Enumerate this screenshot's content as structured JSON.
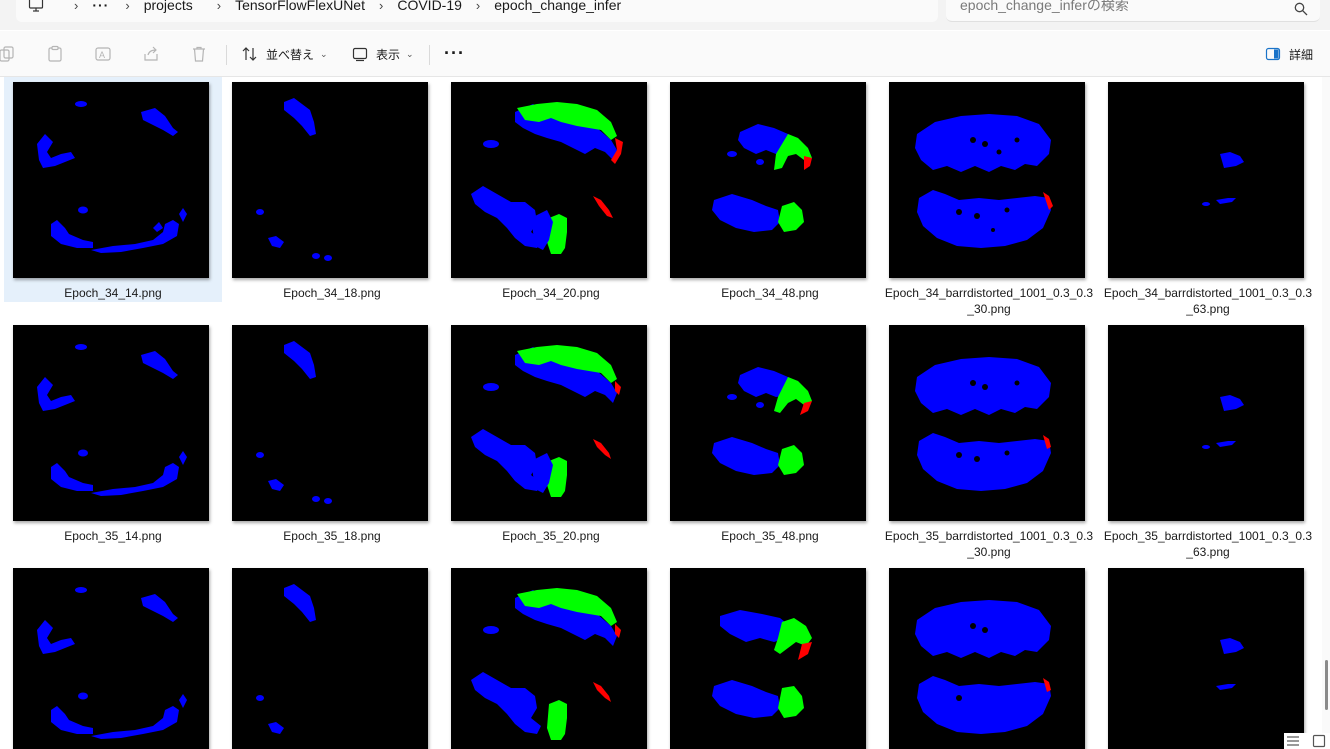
{
  "breadcrumb": {
    "more": "···",
    "items": [
      "projects",
      "TensorFlowFlexUNet",
      "COVID-19",
      "epoch_change_infer"
    ]
  },
  "search": {
    "placeholder": "epoch_change_inferの検索"
  },
  "toolbar": {
    "sort_label": "並べ替え",
    "view_label": "表示",
    "more_label": "···",
    "details_label": "詳細"
  },
  "icons": {
    "pc": "computer-icon",
    "copy": "copy-icon",
    "paste": "paste-icon",
    "rename": "rename-icon",
    "share": "share-icon",
    "delete": "delete-icon",
    "sort": "sort-icon",
    "view": "view-icon",
    "details": "details-pane-icon",
    "search": "search-icon"
  },
  "colors": {
    "selection": "#e5f0fb",
    "seg_blue": "#0000ff",
    "seg_green": "#00ff00",
    "seg_red": "#ff0000",
    "thumb_bg": "#000000"
  },
  "files": [
    [
      "Epoch_34_14.png",
      "Epoch_34_18.png",
      "Epoch_34_20.png",
      "Epoch_34_48.png",
      "Epoch_34_barrdistorted_1001_0.3_0.3_30.png",
      "Epoch_34_barrdistorted_1001_0.3_0.3_63.png"
    ],
    [
      "Epoch_35_14.png",
      "Epoch_35_18.png",
      "Epoch_35_20.png",
      "Epoch_35_48.png",
      "Epoch_35_barrdistorted_1001_0.3_0.3_30.png",
      "Epoch_35_barrdistorted_1001_0.3_0.3_63.png"
    ],
    [
      "",
      "",
      "",
      "",
      "",
      ""
    ]
  ],
  "selected_file": "Epoch_34_14.png"
}
